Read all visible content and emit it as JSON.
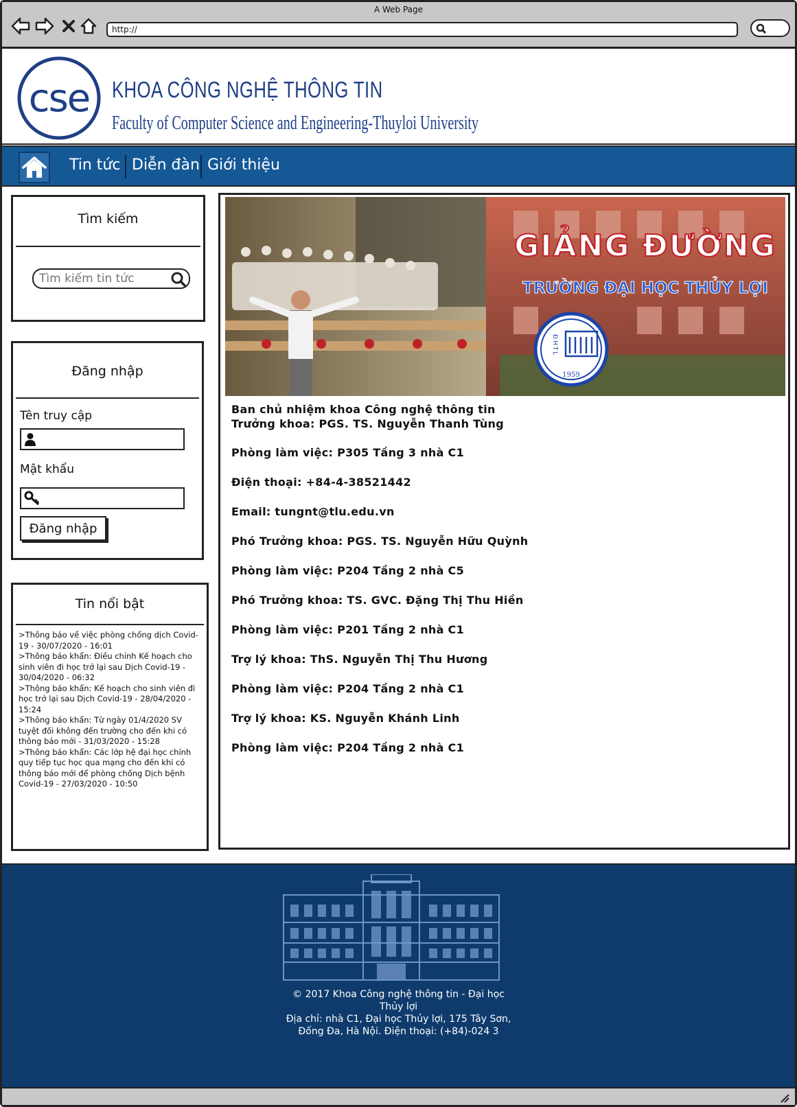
{
  "browser": {
    "window_title": "A Web Page",
    "url": "http://"
  },
  "header": {
    "logo_text": "cse",
    "faculty_name": "KHOA CÔNG NGHỆ THÔNG TIN",
    "faculty_subtitle": "Faculty of Computer Science and Engineering-Thuyloi University"
  },
  "nav": {
    "items": [
      {
        "label": "Tin tức"
      },
      {
        "label": "Diễn đàn"
      },
      {
        "label": "Giới thiệu"
      }
    ]
  },
  "search": {
    "title": "Tìm kiếm",
    "placeholder": "Tìm kiếm tin tức"
  },
  "login": {
    "title": "Đăng nhập",
    "username_label": "Tên truy cập",
    "password_label": "Mật khẩu",
    "button_label": "Đăng nhập"
  },
  "news": {
    "title": "Tin nổi bật",
    "items": [
      ">Thông báo về việc phòng chống dịch Covid-19 - 30/07/2020 - 16:01",
      ">Thông báo khẩn: Điều chỉnh Kế hoạch cho sinh viên đi học trở lại sau Dịch Covid-19 - 30/04/2020 - 06:32",
      ">Thông báo khẩn: Kế hoạch cho sinh viên đi học trở lại sau Dịch Covid-19 - 28/04/2020 - 15:24",
      ">Thông báo khẩn: Từ ngày 01/4/2020 SV tuyệt đối không đến trường cho đến khi có thông báo mới - 31/03/2020 -   15:28",
      ">Thông báo khẩn: Các lớp hệ đại học chính quy tiếp tục học qua mạng cho đến khi có thông báo mới để phòng chống Dịch bệnh Covid-19 - 27/03/2020 - 10:50"
    ]
  },
  "banner": {
    "title": "GIẢNG ĐƯỜNG",
    "subtitle": "TRƯỜNG ĐẠI HỌC THỦY LỢI",
    "seal_letters": "ĐHTL",
    "seal_year": "1959"
  },
  "content": {
    "lines": [
      "Ban chủ nhiệm khoa Công nghệ thông tin",
      "Trưởng khoa: PGS. TS. Nguyễn Thanh Tùng",
      "Phòng làm việc: P305 Tầng 3 nhà C1",
      "Điện thoại: +84-4-38521442",
      "Email: tungnt@tlu.edu.vn",
      "Phó Trưởng khoa: PGS. TS. Nguyễn Hữu Quỳnh",
      "Phòng làm việc: P204 Tầng 2 nhà C5",
      "Phó Trưởng khoa: TS. GVC. Đặng Thị Thu Hiền",
      "Phòng làm việc: P201 Tầng 2 nhà C1",
      "Trợ lý khoa: ThS. Nguyễn Thị Thu Hương",
      "Phòng làm việc: P204 Tầng 2 nhà C1",
      "Trợ lý khoa: KS. Nguyễn Khánh Linh",
      "Phòng làm việc: P204 Tầng 2 nhà C1"
    ]
  },
  "footer": {
    "line1": "© 2017 Khoa Công nghệ thông tin - Đại học",
    "line2": "Thủy lợi",
    "line3": "Địa chỉ: nhà C1, Đại học Thủy lợi, 175 Tây Sơn,",
    "line4": "Đống Đa, Hà Nội. Điện thoại: (+84)-024 3"
  },
  "colors": {
    "nav_bar": "#155896",
    "footer": "#0e3b6c",
    "brand_text": "#1f3f86",
    "banner_title": "#ffffff",
    "banner_subtitle": "#2f5fd0"
  },
  "icons": [
    "back-icon",
    "forward-icon",
    "close-icon",
    "home-icon",
    "search-icon",
    "user-icon",
    "key-icon",
    "resize-grip-icon"
  ]
}
